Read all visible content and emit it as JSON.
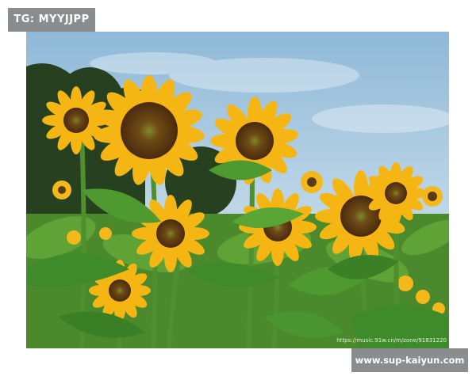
{
  "badges": {
    "tag": "TG: MYYJJPP",
    "site": "www.sup-kaiyun.com"
  },
  "watermark": {
    "text": "https://music.91w.cn/m/zone/91831220"
  },
  "colors": {
    "sky": "#9cc3de",
    "petal": "#f5b614",
    "leaf": "#3f8a2a",
    "badge": "#8a8d90"
  }
}
